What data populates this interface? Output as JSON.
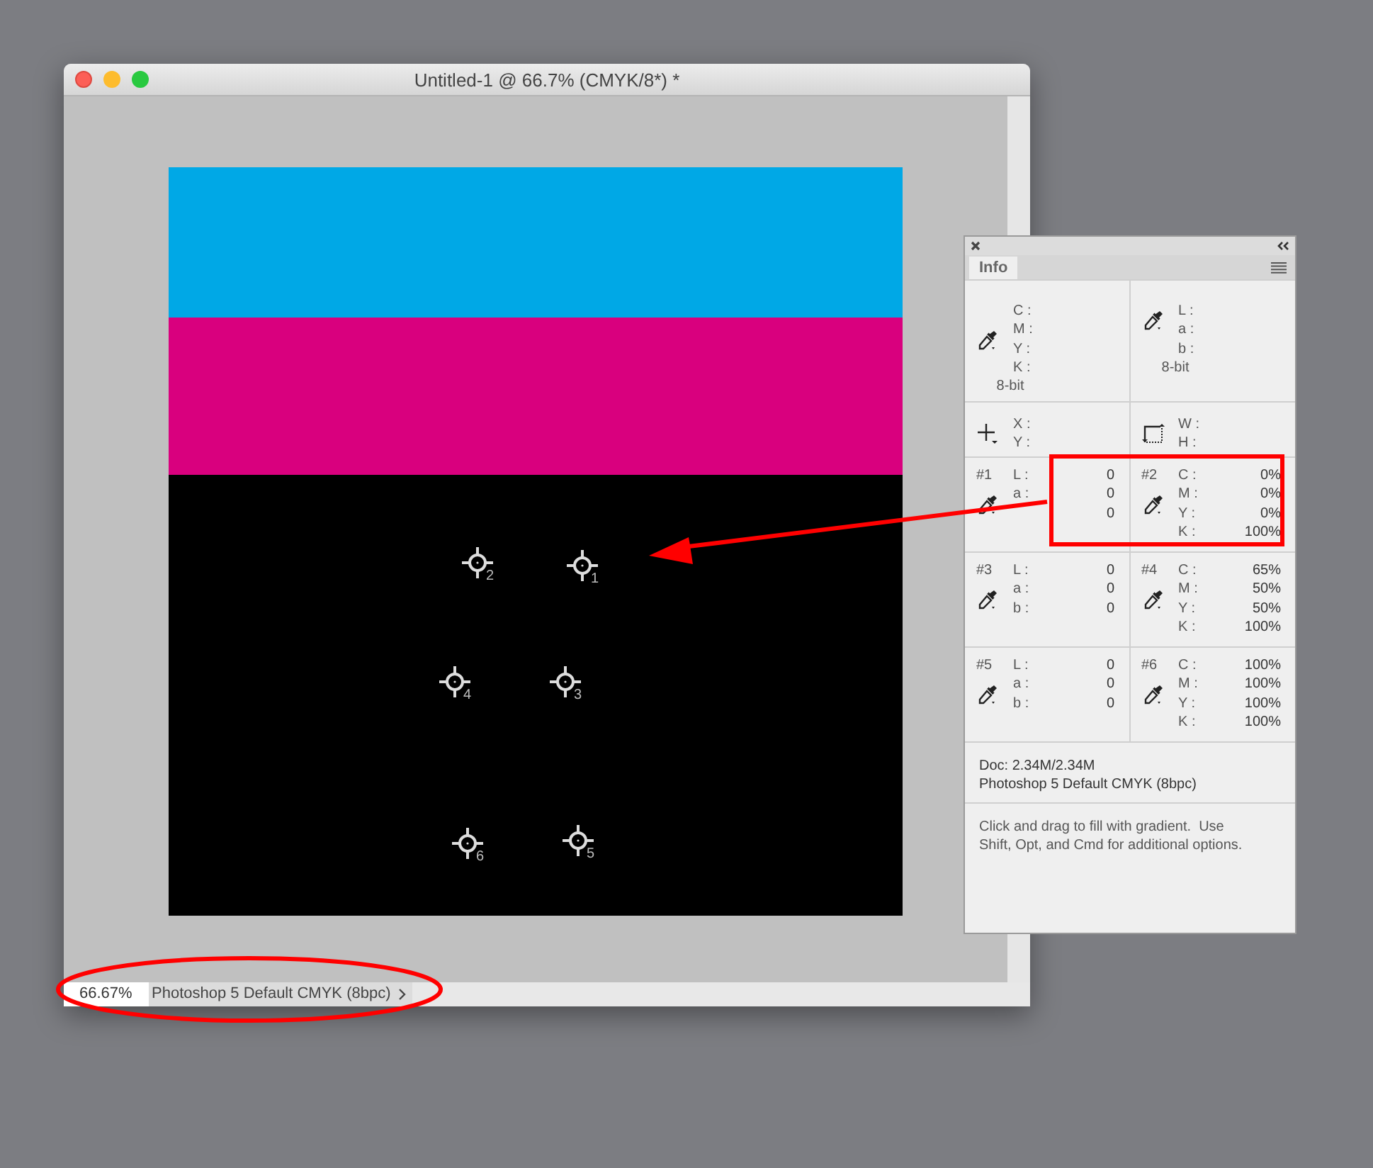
{
  "window": {
    "title": "Untitled-1 @ 66.7% (CMYK/8*) *"
  },
  "canvas": {
    "bands": [
      {
        "color": "#00a8e6"
      },
      {
        "color": "#d9007e"
      },
      {
        "color": "#000000"
      }
    ],
    "samplers": [
      {
        "label": "2"
      },
      {
        "label": "1"
      },
      {
        "label": "4"
      },
      {
        "label": "3"
      },
      {
        "label": "6"
      },
      {
        "label": "5"
      }
    ]
  },
  "status_bar": {
    "zoom": "66.67%",
    "doc_info": "Photoshop 5 Default CMYK (8bpc)"
  },
  "info_panel": {
    "tab": {
      "label": "Info",
      "selected": true
    },
    "readouts": [
      {
        "kind": "eyedropper",
        "rows": [
          {
            "label": "C :"
          },
          {
            "label": "M :"
          },
          {
            "label": "Y :"
          },
          {
            "label": "K :"
          }
        ],
        "depth": "8-bit"
      },
      {
        "kind": "eyedropper",
        "rows": [
          {
            "label": "L :"
          },
          {
            "label": "a :"
          },
          {
            "label": "b :"
          }
        ],
        "depth": "8-bit"
      },
      {
        "kind": "crosshair",
        "rows": [
          {
            "label": "X :"
          },
          {
            "label": "Y :"
          }
        ]
      },
      {
        "kind": "marquee",
        "rows": [
          {
            "label": "W :"
          },
          {
            "label": "H :"
          }
        ]
      },
      {
        "kind": "eyedropper",
        "id": "#1",
        "rows": [
          {
            "label": "L :",
            "value": "0"
          },
          {
            "label": "a :",
            "value": "0"
          },
          {
            "value": "0"
          }
        ]
      },
      {
        "kind": "eyedropper",
        "id": "#2",
        "rows": [
          {
            "label": "C :",
            "value": "0%"
          },
          {
            "label": "M :",
            "value": "0%"
          },
          {
            "label": "Y :",
            "value": "0%"
          },
          {
            "label": "K :",
            "value": "100%"
          }
        ]
      },
      {
        "kind": "eyedropper",
        "id": "#3",
        "rows": [
          {
            "label": "L :",
            "value": "0"
          },
          {
            "label": "a :",
            "value": "0"
          },
          {
            "label": "b :",
            "value": "0"
          }
        ]
      },
      {
        "kind": "eyedropper",
        "id": "#4",
        "rows": [
          {
            "label": "C :",
            "value": "65%"
          },
          {
            "label": "M :",
            "value": "50%"
          },
          {
            "label": "Y :",
            "value": "50%"
          },
          {
            "label": "K :",
            "value": "100%"
          }
        ]
      },
      {
        "kind": "eyedropper",
        "id": "#5",
        "rows": [
          {
            "label": "L :",
            "value": "0"
          },
          {
            "label": "a :",
            "value": "0"
          },
          {
            "label": "b :",
            "value": "0"
          }
        ]
      },
      {
        "kind": "eyedropper",
        "id": "#6",
        "rows": [
          {
            "label": "C :",
            "value": "100%"
          },
          {
            "label": "M :",
            "value": "100%"
          },
          {
            "label": "Y :",
            "value": "100%"
          },
          {
            "label": "K :",
            "value": "100%"
          }
        ]
      }
    ],
    "doc": [
      "Doc: 2.34M/2.34M",
      "Photoshop 5 Default CMYK (8bpc)"
    ],
    "hint_lines": [
      "Click and drag to fill with gradient.  Use",
      "Shift, Opt, and Cmd for additional options."
    ]
  }
}
